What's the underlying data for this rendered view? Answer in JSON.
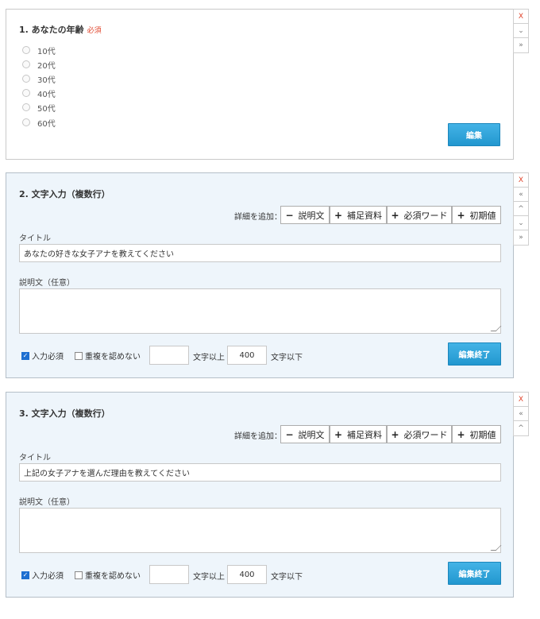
{
  "q1": {
    "title": "1. あなたの年齢",
    "required": "必須",
    "options": [
      "10代",
      "20代",
      "30代",
      "40代",
      "50代",
      "60代"
    ],
    "edit_button": "編集",
    "side": [
      "X",
      "⌄",
      "»"
    ]
  },
  "q2": {
    "title": "2. 文字入力（複数行）",
    "add_detail_label": "詳細を追加：",
    "add_buttons": [
      {
        "sym": "−",
        "label": "説明文"
      },
      {
        "sym": "+",
        "label": "補足資料"
      },
      {
        "sym": "+",
        "label": "必須ワード"
      },
      {
        "sym": "+",
        "label": "初期値"
      }
    ],
    "title_label": "タイトル",
    "title_value": "あなたの好きな女子アナを教えてください",
    "desc_label": "説明文（任意）",
    "required_check": "入力必須",
    "no_dup_check": "重複を認めない",
    "min_value": "",
    "min_unit": "文字以上",
    "max_value": "400",
    "max_unit": "文字以下",
    "done_button": "編集終了",
    "side": [
      "X",
      "«",
      "^",
      "⌄",
      "»"
    ]
  },
  "q3": {
    "title": "3. 文字入力（複数行）",
    "add_detail_label": "詳細を追加：",
    "add_buttons": [
      {
        "sym": "−",
        "label": "説明文"
      },
      {
        "sym": "+",
        "label": "補足資料"
      },
      {
        "sym": "+",
        "label": "必須ワード"
      },
      {
        "sym": "+",
        "label": "初期値"
      }
    ],
    "title_label": "タイトル",
    "title_value": "上記の女子アナを選んだ理由を教えてください",
    "desc_label": "説明文（任意）",
    "required_check": "入力必須",
    "no_dup_check": "重複を認めない",
    "min_value": "",
    "min_unit": "文字以上",
    "max_value": "400",
    "max_unit": "文字以下",
    "done_button": "編集終了",
    "side": [
      "X",
      "«",
      "^"
    ]
  }
}
